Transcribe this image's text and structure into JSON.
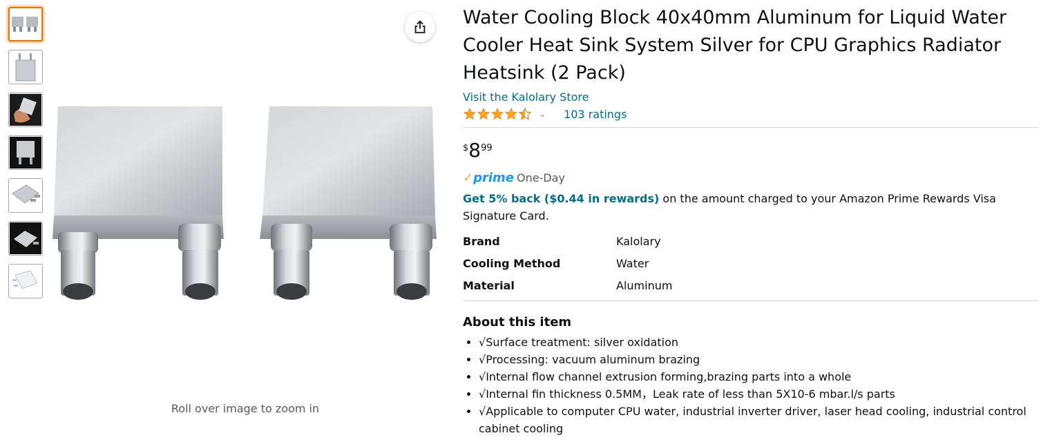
{
  "thumbnails": [
    {
      "name": "thumb-pair"
    },
    {
      "name": "thumb-single-standing"
    },
    {
      "name": "thumb-in-hand"
    },
    {
      "name": "thumb-dark-front"
    },
    {
      "name": "thumb-angled"
    },
    {
      "name": "thumb-dark-angled"
    },
    {
      "name": "thumb-white-angled"
    }
  ],
  "zoom_hint": "Roll over image to zoom in",
  "product": {
    "title": "Water Cooling Block 40x40mm Aluminum for Liquid Water Cooler Heat Sink System Silver for CPU Graphics Radiator Heatsink (2 Pack)",
    "store_link": "Visit the Kalolary Store",
    "rating_value": 4.5,
    "ratings_count": "103 ratings",
    "price": {
      "symbol": "$",
      "whole": "8",
      "fraction": "99"
    },
    "prime_label": "prime",
    "prime_delivery": "One-Day",
    "rewards_link": "Get 5% back ($0.44 in rewards)",
    "rewards_text": " on the amount charged to your Amazon Prime Rewards Visa Signature Card.",
    "specs": [
      {
        "key": "Brand",
        "value": "Kalolary"
      },
      {
        "key": "Cooling Method",
        "value": "Water"
      },
      {
        "key": "Material",
        "value": "Aluminum"
      }
    ],
    "about_title": "About this item",
    "bullets": [
      "√Surface treatment: silver oxidation",
      "√Processing: vacuum aluminum brazing",
      "√Internal flow channel extrusion forming,brazing parts into a whole",
      "√Internal fin thickness 0.5MM，Leak rate of less than 5X10-6 mbar.l/s parts",
      "√Applicable to computer CPU water, industrial inverter driver, laser head cooling, industrial control cabinet cooling"
    ]
  },
  "colors": {
    "link": "#007185",
    "star": "#ffa41c",
    "prime_blue": "#1399ff",
    "prime_check": "#f3a847",
    "thumb_active": "#e77600"
  },
  "icons": {
    "share": "share-icon",
    "star": "star-icon",
    "chevron": "chevron-down-icon"
  }
}
